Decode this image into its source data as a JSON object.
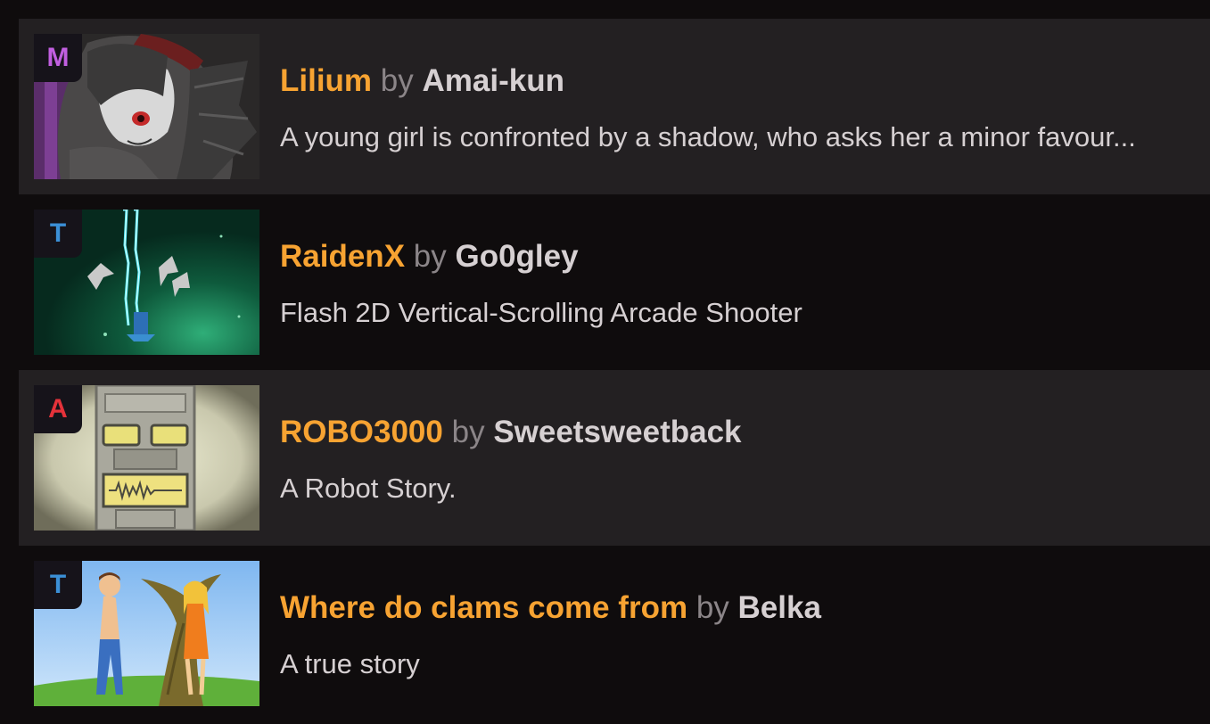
{
  "submissions": [
    {
      "rating": "M",
      "rating_color": "#c15fe0",
      "title": "Lilium",
      "by": "by",
      "author": "Amai-kun",
      "description": "A young girl is confronted by a shadow, who asks her a minor favour..."
    },
    {
      "rating": "T",
      "rating_color": "#3b8fd6",
      "title": "RaidenX",
      "by": "by",
      "author": "Go0gley",
      "description": "Flash 2D Vertical-Scrolling Arcade Shooter"
    },
    {
      "rating": "A",
      "rating_color": "#e5323a",
      "title": "ROBO3000",
      "by": "by",
      "author": "Sweetsweetback",
      "description": "A Robot Story."
    },
    {
      "rating": "T",
      "rating_color": "#3b8fd6",
      "title": "Where do clams come from",
      "by": "by",
      "author": "Belka",
      "description": "A true story"
    }
  ]
}
